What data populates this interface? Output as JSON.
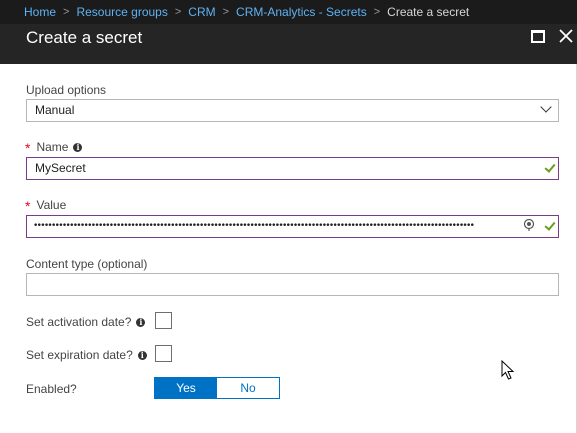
{
  "breadcrumb": {
    "items": [
      "Home",
      "Resource groups",
      "CRM",
      "CRM-Analytics - Secrets"
    ],
    "current": "Create a secret",
    "separator": ">"
  },
  "header": {
    "title": "Create a secret"
  },
  "form": {
    "upload_options": {
      "label": "Upload options",
      "value": "Manual"
    },
    "name": {
      "label": "Name",
      "required": true,
      "value": "MySecret"
    },
    "value": {
      "label": "Value",
      "required": true,
      "masked_value": "••••••••••••••••••••••••••••••••••••••••••••••••••••••••••••••••••••••••••••••••••••••••••••••••••••••••••••••••••••••••••"
    },
    "content_type": {
      "label": "Content type (optional)",
      "value": ""
    },
    "activation_date": {
      "label": "Set activation date?",
      "checked": false
    },
    "expiration_date": {
      "label": "Set expiration date?",
      "checked": false
    },
    "enabled": {
      "label": "Enabled?",
      "options": [
        "Yes",
        "No"
      ],
      "selected": "Yes"
    }
  },
  "colors": {
    "accent": "#0072c6",
    "link": "#5fb2f2",
    "required": "#e00b1c",
    "valid_border": "#7a3b88",
    "valid_check": "#6a9c1f",
    "header_bg": "#252526"
  },
  "icons": [
    "info-icon",
    "chevron-down-icon",
    "check-icon",
    "reveal-icon",
    "maximize-icon",
    "close-icon",
    "mouse-cursor-icon"
  ]
}
